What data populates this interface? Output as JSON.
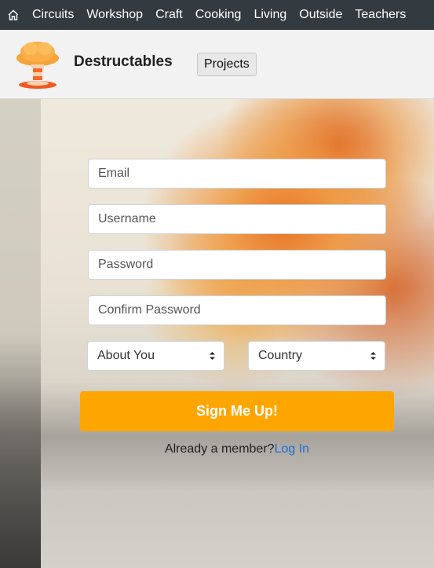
{
  "topnav": {
    "home_icon": "home-icon",
    "links": [
      "Circuits",
      "Workshop",
      "Craft",
      "Cooking",
      "Living",
      "Outside",
      "Teachers"
    ]
  },
  "header": {
    "logo_icon": "mushroom-cloud-logo",
    "brand": "Destructables",
    "projects_label": "Projects"
  },
  "form": {
    "email_placeholder": "Email",
    "username_placeholder": "Username",
    "password_placeholder": "Password",
    "confirm_password_placeholder": "Confirm Password",
    "about_you": "About You",
    "country": "Country",
    "submit_label": "Sign Me Up!",
    "member_text": "Already a member?",
    "login_label": "Log In"
  },
  "colors": {
    "nav_bg": "#333a40",
    "accent_orange": "#ffa500",
    "link_blue": "#1a6fd8"
  }
}
